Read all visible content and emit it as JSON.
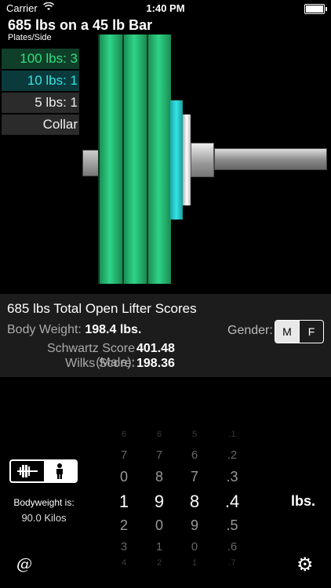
{
  "status_bar": {
    "carrier": "Carrier",
    "time": "1:40 PM"
  },
  "header": {
    "title": "685 lbs on a 45 lb Bar",
    "subtitle": "Plates/Side"
  },
  "plates": [
    {
      "label": "100 lbs: 3",
      "color": "#30e080"
    },
    {
      "label": "10 lbs: 1",
      "color": "#35e4e4"
    },
    {
      "label": "5 lbs: 1",
      "color": "#f0f0f0"
    },
    {
      "label": "Collar",
      "color": "#f0f0f0"
    }
  ],
  "scores": {
    "title": "685 lbs Total Open Lifter Scores",
    "body_weight_label": "Body Weight:",
    "body_weight_value": "198.4 lbs.",
    "gender_label": "Gender:",
    "gender_m": "M",
    "gender_f": "F",
    "schwartz_label": "Schwartz Score (Male):",
    "schwartz_value": "401.48",
    "wilks_label": "Wilks Score:",
    "wilks_value": "198.36"
  },
  "bodyweight_note": {
    "label": "Bodyweight is:",
    "value": "90.0 Kilos"
  },
  "picker": {
    "columns": [
      [
        "6",
        "7",
        "0",
        "1",
        "2",
        "3",
        "4"
      ],
      [
        "6",
        "7",
        "8",
        "9",
        "0",
        "1",
        "2"
      ],
      [
        "5",
        "6",
        "7",
        "8",
        "9",
        "0",
        "1"
      ],
      [
        ".1",
        ".2",
        ".3",
        ".4",
        ".5",
        ".6",
        ".7"
      ]
    ],
    "unit": "lbs."
  },
  "colors": {
    "accent_green": "#30e080",
    "accent_cyan": "#35e4e4",
    "panel": "#1c1c1c"
  }
}
